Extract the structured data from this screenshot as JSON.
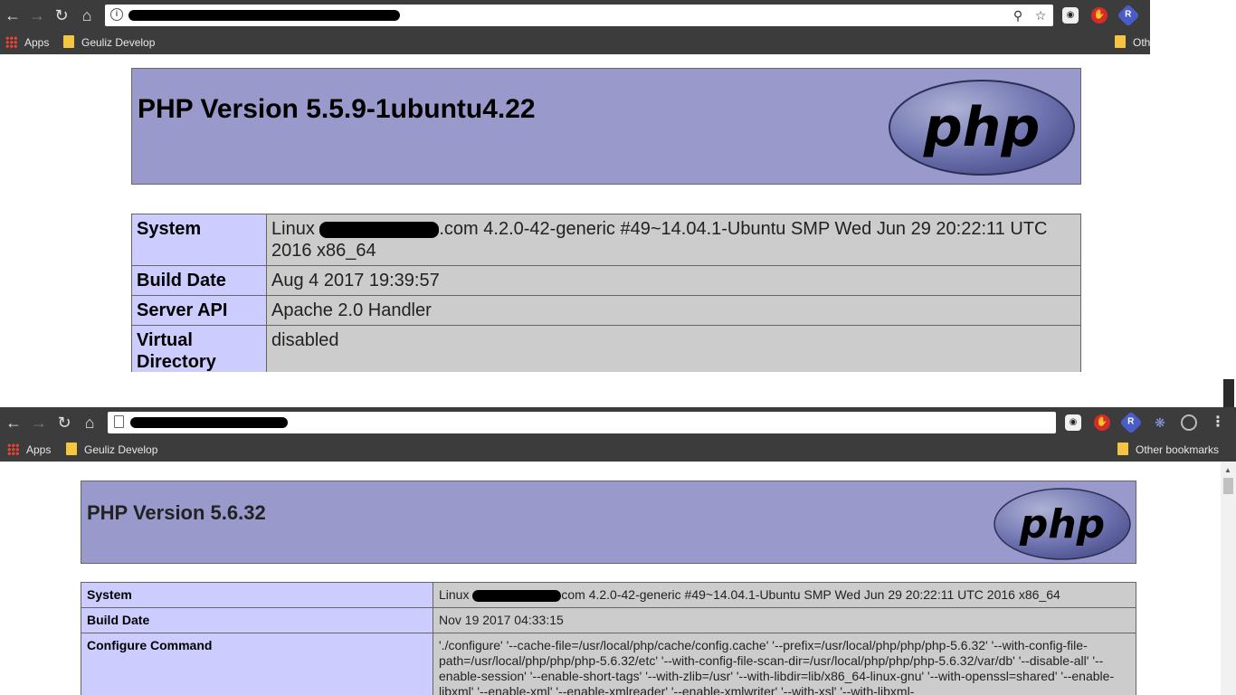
{
  "window1": {
    "bookmarks": [
      {
        "label": "Apps"
      },
      {
        "label": "Geuliz Develop"
      }
    ],
    "bookmarks_other": "Oth",
    "php": {
      "title": "PHP Version 5.5.9-1ubuntu4.22",
      "logo_text": "php",
      "rows": [
        {
          "key": "System",
          "value_pre": "Linux",
          "value_post": ".com 4.2.0-42-generic #49~14.04.1-Ubuntu SMP Wed Jun 29 20:22:11 UTC 2016 x86_64"
        },
        {
          "key": "Build Date",
          "value": "Aug 4 2017 19:39:57"
        },
        {
          "key": "Server API",
          "value": "Apache 2.0 Handler"
        },
        {
          "key": "Virtual Directory Support",
          "value": "disabled"
        }
      ]
    },
    "extensions": [
      "R"
    ]
  },
  "window2": {
    "bookmarks": [
      {
        "label": "Apps"
      },
      {
        "label": "Geuliz Develop"
      }
    ],
    "bookmarks_other": "Other bookmarks",
    "php": {
      "title": "PHP Version 5.6.32",
      "logo_text": "php",
      "rows": [
        {
          "key": "System",
          "value_pre": "Linux",
          "value_post": "com 4.2.0-42-generic #49~14.04.1-Ubuntu SMP Wed Jun 29 20:22:11 UTC 2016 x86_64"
        },
        {
          "key": "Build Date",
          "value": "Nov 19 2017 04:33:15"
        },
        {
          "key": "Configure Command",
          "value": "'./configure' '--cache-file=/usr/local/php/cache/config.cache' '--prefix=/usr/local/php/php/php-5.6.32' '--with-config-file-path=/usr/local/php/php/php-5.6.32/etc' '--with-config-file-scan-dir=/usr/local/php/php/php-5.6.32/var/db' '--disable-all' '--enable-session' '--enable-short-tags' '--with-zlib=/usr' '--with-libdir=lib/x86_64-linux-gnu' '--with-openssl=shared' '--enable-libxml' '--enable-xml' '--enable-xmlreader' '--enable-xmlwriter' '--with-xsl' '--with-libxml-"
        }
      ]
    },
    "extensions": [
      "R"
    ]
  },
  "colors": {
    "chrome_dark": "#3c3c3c",
    "php_header": "#9999cc",
    "php_key": "#ccccff",
    "php_value": "#cccccc"
  }
}
